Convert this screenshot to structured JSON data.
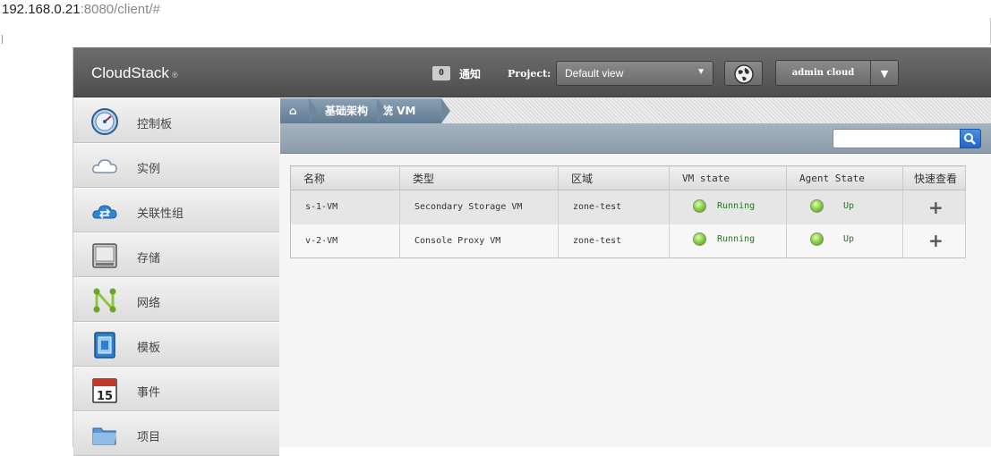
{
  "browser": {
    "url_host": "192.168.0.21",
    "url_rest": ":8080/client/#"
  },
  "header": {
    "logo": "CloudStack",
    "logo_mark": "®",
    "notifications": {
      "count": "0",
      "label": "通知"
    },
    "project_label": "Project:",
    "project_selected": "Default view",
    "user": "admin cloud"
  },
  "sidebar": {
    "items": [
      {
        "label": "控制板",
        "icon": "dashboard-icon"
      },
      {
        "label": "实例",
        "icon": "cloud-instances-icon"
      },
      {
        "label": "关联性组",
        "icon": "affinity-groups-icon"
      },
      {
        "label": "存储",
        "icon": "storage-icon"
      },
      {
        "label": "网络",
        "icon": "network-icon"
      },
      {
        "label": "模板",
        "icon": "templates-icon"
      },
      {
        "label": "事件",
        "icon": "events-calendar-icon",
        "calendar_day": "15"
      },
      {
        "label": "项目",
        "icon": "projects-folder-icon"
      }
    ]
  },
  "breadcrumb": {
    "home": "⌂",
    "level1": "基础架构",
    "level2": "系统 VM"
  },
  "search": {
    "placeholder": ""
  },
  "table": {
    "columns": [
      "名称",
      "类型",
      "区域",
      "VM state",
      "Agent State",
      "快速查看"
    ],
    "rows": [
      {
        "name": "s-1-VM",
        "type": "Secondary Storage VM",
        "zone": "zone-test",
        "vm_state": "Running",
        "agent_state": "Up",
        "quickview": "+"
      },
      {
        "name": "v-2-VM",
        "type": "Console Proxy VM",
        "zone": "zone-test",
        "vm_state": "Running",
        "agent_state": "Up",
        "quickview": "+"
      }
    ]
  },
  "colors": {
    "header": "#5a5a5a",
    "crumb": "#6f88a0",
    "status_text": "#1f7a1f",
    "search_button": "#2a73d0"
  }
}
